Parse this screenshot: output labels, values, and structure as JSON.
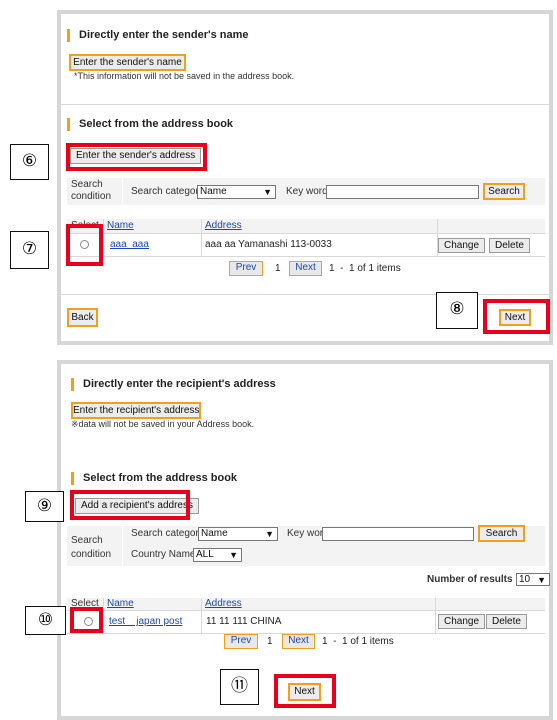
{
  "sender": {
    "direct_title": "Directly enter the sender's name",
    "enter_name_button": "Enter the sender's name",
    "enter_name_note": "*This information will not be saved in the address book.",
    "book_title": "Select from the address book",
    "enter_address_button": "Enter the sender's address",
    "search_condition": "Search condition",
    "search_category_label": "Search category",
    "search_category_value": "Name",
    "keyword_label": "Key word",
    "search_button": "Search",
    "table_headers": [
      "Select",
      "Name",
      "Address"
    ],
    "rows": [
      {
        "name": "aaa  aaa",
        "address": "aaa aa Yamanashi 113-0033",
        "change": "Change",
        "delete": "Delete"
      }
    ],
    "pager": {
      "prev": "Prev",
      "page": "1",
      "next": "Next",
      "info": "1  -  1 of 1 items"
    },
    "back_button": "Back",
    "next_button": "Next"
  },
  "recipient": {
    "direct_title": "Directly enter the recipient's address",
    "enter_address_button": "Enter the recipient's address",
    "enter_address_note": "※data will not be saved in your Address book.",
    "book_title": "Select from the address book",
    "add_button": "Add a recipient's address",
    "search_condition": "Search condition",
    "search_category_label": "Search category",
    "search_category_value": "Name",
    "keyword_label": "Key word",
    "search_button": "Search",
    "country_label": "Country Name",
    "country_value": "ALL",
    "results_label": "Number of results",
    "results_value": "10",
    "table_headers": [
      "Select",
      "Name",
      "Address"
    ],
    "rows": [
      {
        "name": "test    japan post",
        "address": "11 11 111 CHINA",
        "change": "Change",
        "delete": "Delete"
      }
    ],
    "pager": {
      "prev": "Prev",
      "page": "1",
      "next": "Next",
      "info": "1  -  1 of 1 items"
    },
    "next_button": "Next"
  },
  "step_markers": {
    "s6": "⑥",
    "s7": "⑦",
    "s8": "⑧",
    "s9": "⑨",
    "s10": "⑩",
    "s11": "⑪"
  },
  "colors": {
    "accent": "#f0a020",
    "highlight": "#e8001c",
    "link": "#1a47b8",
    "panel_border": "#d6d6d6"
  }
}
